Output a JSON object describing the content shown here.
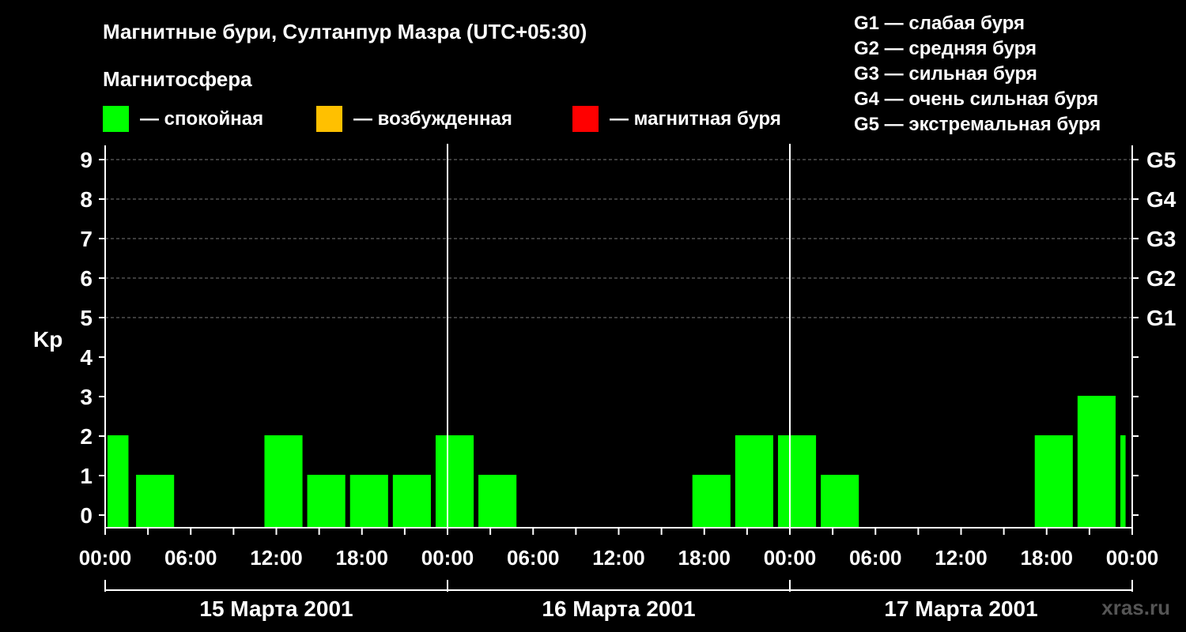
{
  "chart_data": {
    "type": "bar",
    "title": "Магнитные бури, Султанпур Мазра (UTC+05:30)",
    "legend_title": "Магнитосфера",
    "legend": [
      {
        "name": "— спокойная",
        "color": "#00ff00"
      },
      {
        "name": "— возбужденная",
        "color": "#ffc000"
      },
      {
        "name": "— магнитная буря",
        "color": "#ff0000"
      }
    ],
    "g_scale": [
      "G1 — слабая буря",
      "G2 — средняя буря",
      "G3 — сильная буря",
      "G4 — очень сильная буря",
      "G5 — экстремальная буря"
    ],
    "ylabel": "Kp",
    "ylim": [
      0,
      9
    ],
    "y_ticks": [
      "0",
      "1",
      "2",
      "3",
      "4",
      "5",
      "6",
      "7",
      "8",
      "9"
    ],
    "right_axis_labels": [
      {
        "level": 5,
        "label": "G1"
      },
      {
        "level": 6,
        "label": "G2"
      },
      {
        "level": 7,
        "label": "G3"
      },
      {
        "level": 8,
        "label": "G4"
      },
      {
        "level": 9,
        "label": "G5"
      }
    ],
    "grid": "dashed horizontal at each Kp level 5–9",
    "x_range_hours": [
      0,
      72
    ],
    "x_tick_labels": [
      "00:00",
      "06:00",
      "12:00",
      "18:00",
      "00:00",
      "06:00",
      "12:00",
      "18:00",
      "00:00",
      "06:00",
      "12:00",
      "18:00",
      "00:00"
    ],
    "day_labels": [
      "15 Марта 2001",
      "16 Марта 2001",
      "17 Марта 2001"
    ],
    "bars": [
      {
        "start_h": 0,
        "end_h": 1.8,
        "kp": 2,
        "color": "#00ff00"
      },
      {
        "start_h": 2,
        "end_h": 5,
        "kp": 1,
        "color": "#00ff00"
      },
      {
        "start_h": 11,
        "end_h": 14,
        "kp": 2,
        "color": "#00ff00"
      },
      {
        "start_h": 14,
        "end_h": 17,
        "kp": 1,
        "color": "#00ff00"
      },
      {
        "start_h": 17,
        "end_h": 20,
        "kp": 1,
        "color": "#00ff00"
      },
      {
        "start_h": 20,
        "end_h": 23,
        "kp": 1,
        "color": "#00ff00"
      },
      {
        "start_h": 23,
        "end_h": 26,
        "kp": 2,
        "color": "#00ff00"
      },
      {
        "start_h": 26,
        "end_h": 29,
        "kp": 1,
        "color": "#00ff00"
      },
      {
        "start_h": 41,
        "end_h": 44,
        "kp": 1,
        "color": "#00ff00"
      },
      {
        "start_h": 44,
        "end_h": 47,
        "kp": 2,
        "color": "#00ff00"
      },
      {
        "start_h": 47,
        "end_h": 50,
        "kp": 2,
        "color": "#00ff00"
      },
      {
        "start_h": 50,
        "end_h": 53,
        "kp": 1,
        "color": "#00ff00"
      },
      {
        "start_h": 65,
        "end_h": 68,
        "kp": 2,
        "color": "#00ff00"
      },
      {
        "start_h": 68,
        "end_h": 71,
        "kp": 3,
        "color": "#00ff00"
      },
      {
        "start_h": 71,
        "end_h": 71.7,
        "kp": 2,
        "color": "#00ff00"
      }
    ],
    "watermark": "xras.ru"
  }
}
